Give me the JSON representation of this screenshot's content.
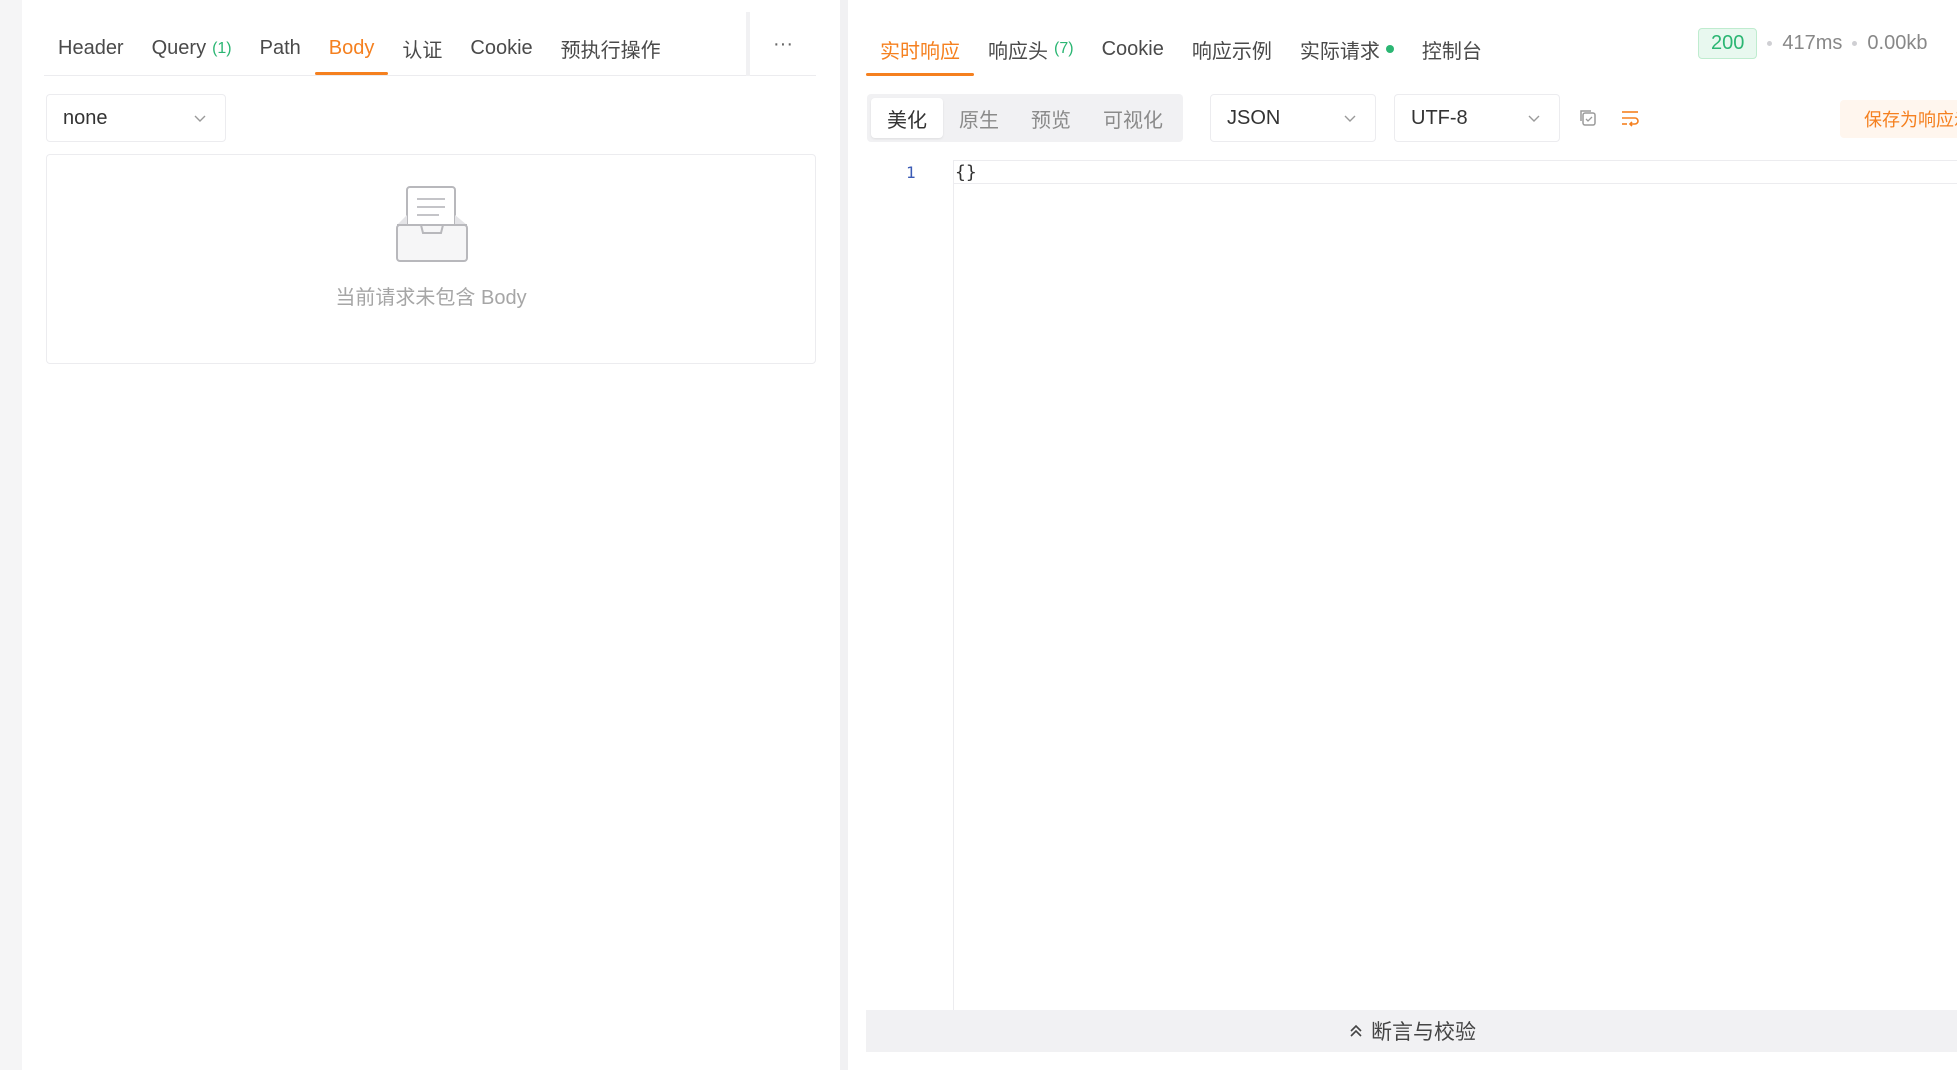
{
  "request_tabs": [
    {
      "label": "Header",
      "count": ""
    },
    {
      "label": "Query",
      "count": "(1)"
    },
    {
      "label": "Path",
      "count": ""
    },
    {
      "label": "Body",
      "count": "",
      "active": true
    },
    {
      "label": "认证",
      "count": ""
    },
    {
      "label": "Cookie",
      "count": ""
    },
    {
      "label": "预执行操作",
      "count": ""
    }
  ],
  "request_tabs_more": "···",
  "body_type": {
    "value": "none"
  },
  "body_empty_text": "当前请求未包含 Body",
  "response_tabs": [
    {
      "label": "实时响应",
      "count": "",
      "active": true
    },
    {
      "label": "响应头",
      "count": "(7)"
    },
    {
      "label": "Cookie",
      "count": ""
    },
    {
      "label": "响应示例",
      "count": ""
    },
    {
      "label": "实际请求",
      "count": ""
    },
    {
      "label": "控制台",
      "count": ""
    }
  ],
  "status": {
    "code": "200",
    "time": "417ms",
    "size": "0.00kb"
  },
  "view_modes": [
    "美化",
    "原生",
    "预览",
    "可视化"
  ],
  "format_select": {
    "value": "JSON"
  },
  "encoding_select": {
    "value": "UTF-8"
  },
  "save_button_label": "保存为响应示例",
  "editor": {
    "line_numbers": [
      "1"
    ],
    "lines": [
      "{}"
    ]
  },
  "assert_bar_label": "断言与校验",
  "colors": {
    "accent": "#f5801f",
    "success": "#2bb673"
  },
  "icons": [
    "chevron-down-icon",
    "copy-icon",
    "wrap-lines-icon",
    "empty-box-icon",
    "chevron-double-up-icon"
  ]
}
